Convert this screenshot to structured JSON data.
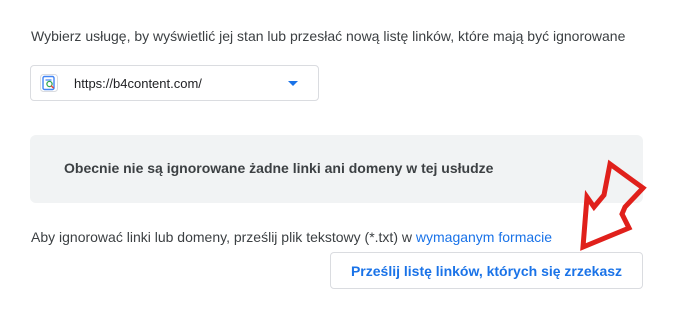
{
  "intro_text": "Wybierz usługę, by wyświetlić jej stan lub przesłać nową listę linków, które mają być ignorowane",
  "property_select": {
    "value": "https://b4content.com/",
    "icon": "search-console-property-icon",
    "expand_icon": "dropdown-caret-icon"
  },
  "empty_state": {
    "message": "Obecnie nie są ignorowane żadne linki ani domeny w tej usłudze"
  },
  "hint": {
    "text": "Aby ignorować linki lub domeny, prześlij plik tekstowy (*.txt) w ",
    "link_label": "wymaganym formacie"
  },
  "upload_button": {
    "label": "Prześlij listę linków, których się zrzekasz"
  },
  "annotation": {
    "icon": "red-arrow-icon",
    "color": "#e0201b"
  },
  "colors": {
    "accent": "#1a73e8",
    "panel_bg": "#f1f3f4",
    "border": "#dadce0"
  }
}
